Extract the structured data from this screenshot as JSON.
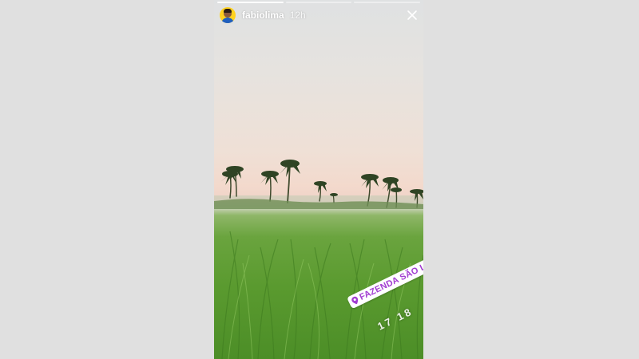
{
  "story": {
    "progress_segments": 3,
    "active_segment": 1,
    "username": "fabiolima",
    "time_ago": "12h",
    "close_icon": "close-icon",
    "location_sticker": "FAZENDA SÃO LUIZ",
    "time_sticker": "17 18",
    "accent_color": "#a23dd1"
  }
}
